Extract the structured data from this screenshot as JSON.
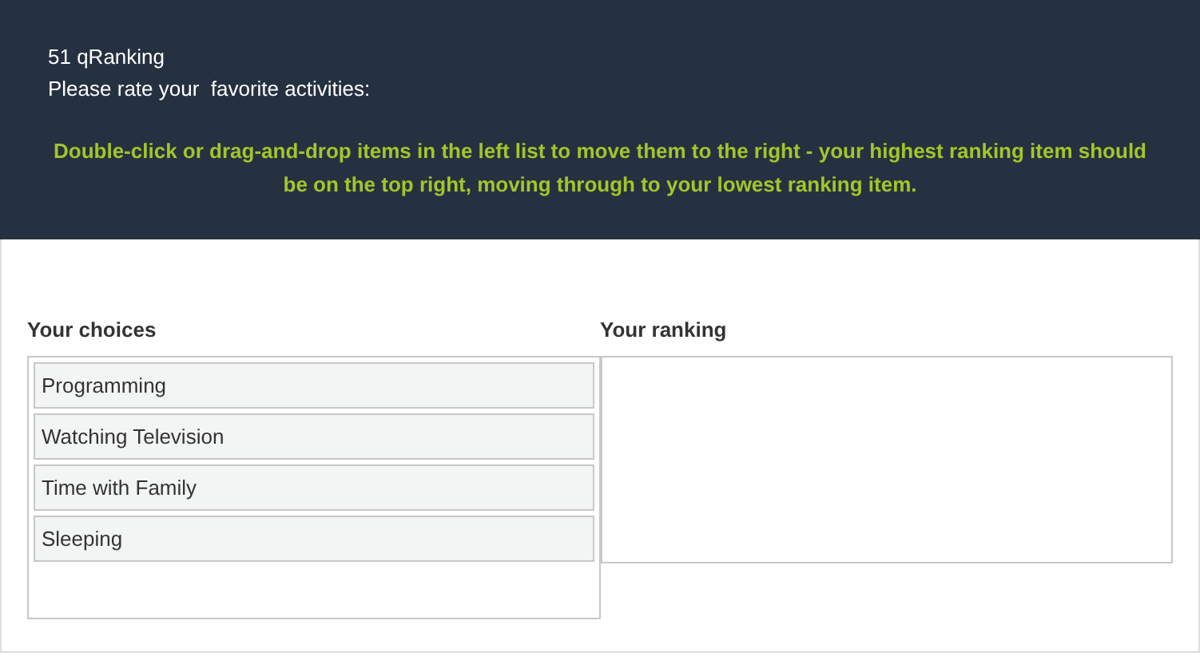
{
  "question": {
    "number": "51",
    "type_label": "qRanking",
    "prompt": "Please rate your  favorite activities:",
    "instruction": "Double-click or drag-and-drop items in the left list to move them to the right - your highest ranking item should be on the top right, moving through to your lowest ranking item."
  },
  "choices": {
    "heading": "Your choices",
    "items": [
      "Programming",
      "Watching Television",
      "Time with Family",
      "Sleeping"
    ]
  },
  "ranking": {
    "heading": "Your ranking"
  }
}
